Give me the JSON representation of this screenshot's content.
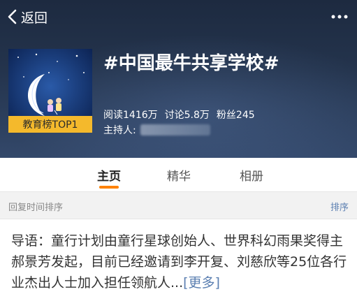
{
  "nav": {
    "back_label": "返回",
    "more_icon": "more-dots-icon",
    "back_icon": "chevron-left-icon"
  },
  "topic": {
    "title": "#中国最牛共享学校#",
    "cover_badge": "教育榜TOP1",
    "reads": "阅读1416万",
    "discussions": "讨论5.8万",
    "fans": "粉丝245",
    "host_label": "主持人:"
  },
  "tabs": [
    {
      "label": "主页",
      "active": true
    },
    {
      "label": "精华",
      "active": false
    },
    {
      "label": "相册",
      "active": false
    }
  ],
  "sort": {
    "label": "回复时间排序",
    "button": "排序"
  },
  "intro": {
    "text": "导语：童行计划由童行星球创始人、世界科幻雨果奖得主郝景芳发起，目前已经邀请到李开复、刘慈欣等25位各行业杰出人士加入担任领航人...",
    "more": "[更多]"
  },
  "colors": {
    "accent": "#ff8200",
    "link": "#5b7fb1",
    "badge": "#f4b92c"
  }
}
